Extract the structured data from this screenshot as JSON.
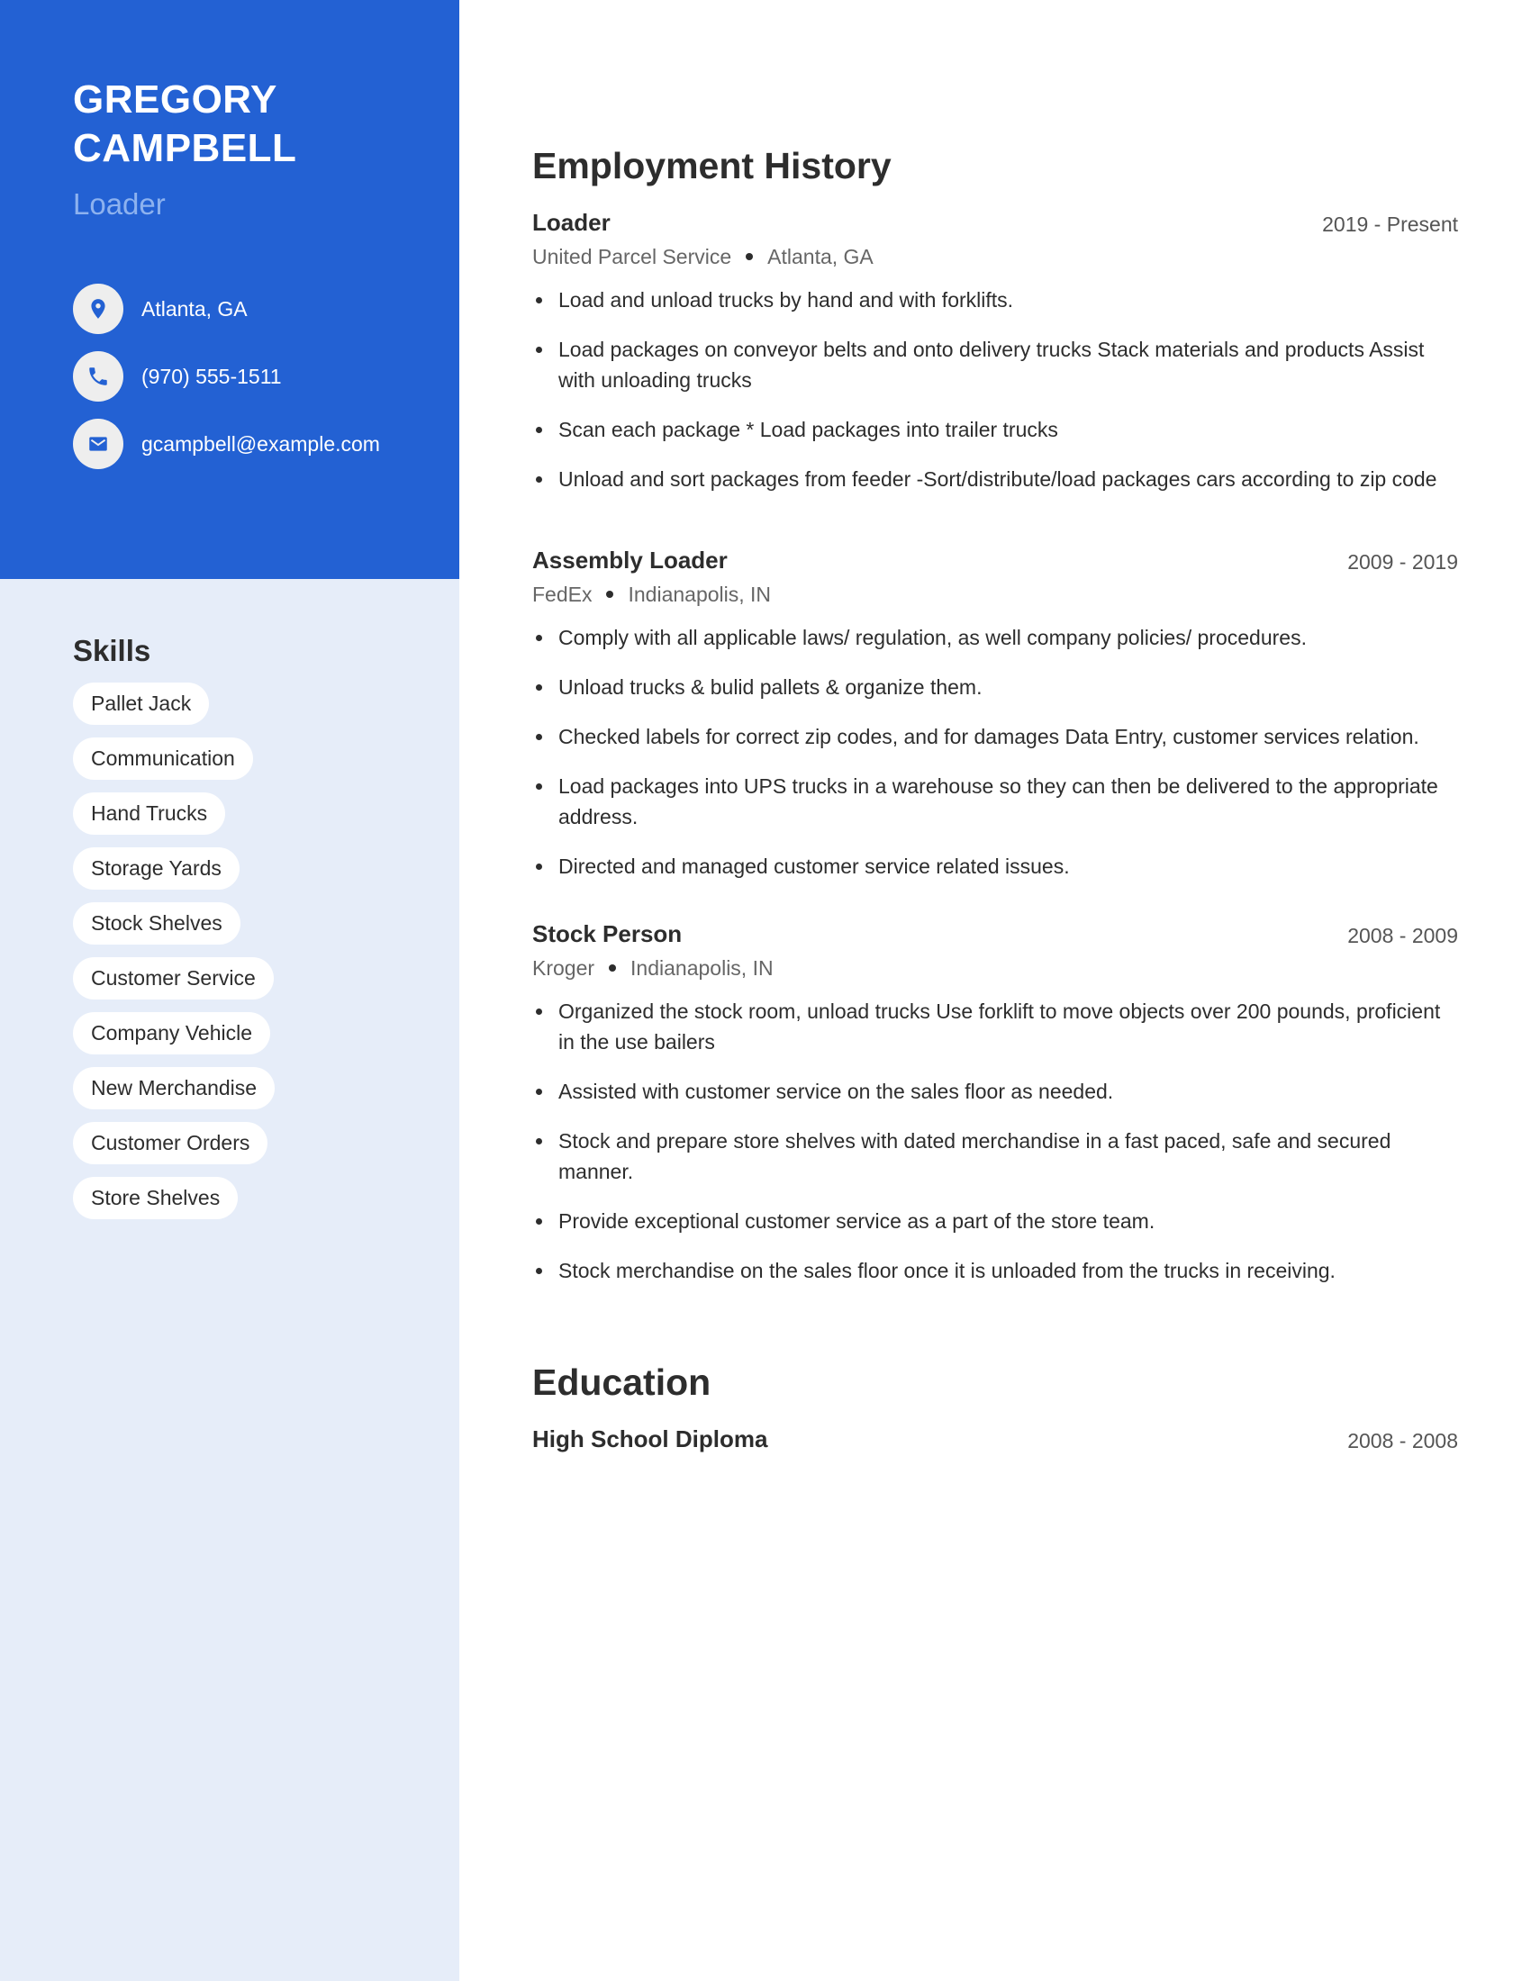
{
  "profile": {
    "name_first": "GREGORY",
    "name_last": "CAMPBELL",
    "title": "Loader",
    "contacts": [
      {
        "icon": "location-pin-icon",
        "text": "Atlanta, GA"
      },
      {
        "icon": "phone-icon",
        "text": "(970) 555-1511"
      },
      {
        "icon": "email-icon",
        "text": "gcampbell@example.com"
      }
    ]
  },
  "skills": {
    "heading": "Skills",
    "items": [
      "Pallet Jack",
      "Communication",
      "Hand Trucks",
      "Storage Yards",
      "Stock Shelves",
      "Customer Service",
      "Company Vehicle",
      "New Merchandise",
      "Customer Orders",
      "Store Shelves"
    ]
  },
  "employment": {
    "heading": "Employment History",
    "jobs": [
      {
        "title": "Loader",
        "dates": "2019 - Present",
        "company": "United Parcel Service",
        "location": "Atlanta, GA",
        "bullets": [
          "Load and unload trucks by hand and with forklifts.",
          "Load packages on conveyor belts and onto delivery trucks Stack materials and products Assist with unloading trucks",
          "Scan each package * Load packages into trailer trucks",
          "Unload and sort packages from feeder -Sort/distribute/load packages cars according to zip code"
        ]
      },
      {
        "title": "Assembly Loader",
        "dates": "2009 - 2019",
        "company": "FedEx",
        "location": "Indianapolis, IN",
        "bullets": [
          "Comply with all applicable laws/ regulation, as well company policies/ procedures.",
          "Unload trucks & bulid pallets & organize them.",
          "Checked labels for correct zip codes, and for damages Data Entry, customer services relation.",
          "Load packages into UPS trucks in a warehouse so they can then be delivered to the appropriate address.",
          "Directed and managed customer service related issues."
        ]
      },
      {
        "title": "Stock Person",
        "dates": "2008 - 2009",
        "company": "Kroger",
        "location": "Indianapolis, IN",
        "bullets": [
          "Organized the stock room, unload trucks Use forklift to move objects over 200 pounds, proficient in the use bailers",
          "Assisted with customer service on the sales floor as needed.",
          "Stock and prepare store shelves with dated merchandise in a fast paced, safe and secured manner.",
          "Provide exceptional customer service as a part of the store team.",
          "Stock merchandise on the sales floor once it is unloaded from the trucks in receiving."
        ]
      }
    ]
  },
  "education": {
    "heading": "Education",
    "items": [
      {
        "degree": "High School Diploma",
        "dates": "2008 - 2008"
      }
    ]
  },
  "colors": {
    "header_blue": "#2361d3",
    "sidebar_bg": "#e6edf9",
    "title_light_blue": "#8db2ef",
    "text_dark": "#2d2d2d",
    "text_muted": "#666666"
  }
}
